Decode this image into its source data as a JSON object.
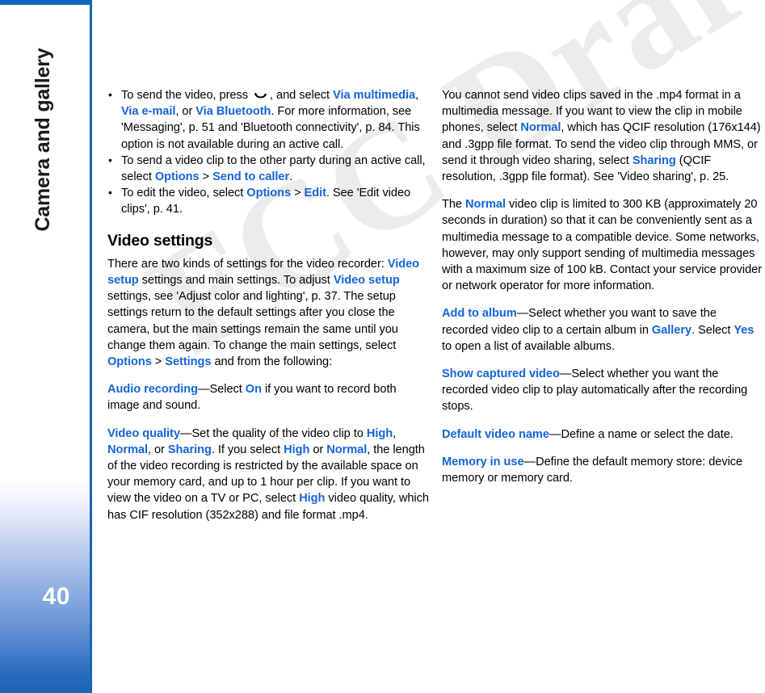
{
  "document": {
    "chapter_title": "Camera and gallery",
    "page_number": "40",
    "watermark_text": "FCC Draft",
    "accent_color": "#1565d8",
    "sidebar_border_color": "#1565c0",
    "sidebar_gradient_end": "#1b63b5"
  },
  "column_left": {
    "bullets": [
      {
        "id": "bullet-send-video",
        "segments": [
          {
            "t": "To send the video, press "
          },
          {
            "t": "",
            "icon": "call-key-icon"
          },
          {
            "t": ", and select "
          },
          {
            "t": "Via multimedia",
            "kw": true
          },
          {
            "t": ", "
          },
          {
            "t": "Via e-mail",
            "kw": true
          },
          {
            "t": ", or "
          },
          {
            "t": "Via Bluetooth",
            "kw": true
          },
          {
            "t": ". For more information, see 'Messaging', p. 51 and 'Bluetooth connectivity', p. 84. This option is not available during an active call."
          }
        ]
      },
      {
        "id": "bullet-send-to-caller",
        "segments": [
          {
            "t": "To send a video clip to the other party during an active call, select "
          },
          {
            "t": "Options",
            "kw": true
          },
          {
            "t": " > "
          },
          {
            "t": "Send to caller",
            "kw": true
          },
          {
            "t": "."
          }
        ]
      },
      {
        "id": "bullet-edit-video",
        "segments": [
          {
            "t": "To edit the video, select "
          },
          {
            "t": "Options",
            "kw": true
          },
          {
            "t": " > "
          },
          {
            "t": "Edit",
            "kw": true
          },
          {
            "t": ". See 'Edit video clips', p. 41."
          }
        ]
      }
    ],
    "heading": "Video settings",
    "paragraphs": [
      {
        "id": "para-video-settings-intro",
        "segments": [
          {
            "t": "There are two kinds of settings for the video recorder: "
          },
          {
            "t": "Video setup",
            "kw": true
          },
          {
            "t": " settings and main settings. To adjust "
          },
          {
            "t": "Video setup",
            "kw": true
          },
          {
            "t": " settings, see 'Adjust color and lighting', p. 37. The setup settings return to the default settings after you close the camera, but the main settings remain the same until you change them again. To change the main settings, select "
          },
          {
            "t": "Options",
            "kw": true
          },
          {
            "t": " > "
          },
          {
            "t": "Settings",
            "kw": true
          },
          {
            "t": " and from the following:"
          }
        ]
      },
      {
        "id": "para-audio-recording",
        "segments": [
          {
            "t": "Audio recording",
            "kw": true
          },
          {
            "t": "—Select "
          },
          {
            "t": "On",
            "kw": true
          },
          {
            "t": " if you want to record both image and sound."
          }
        ]
      },
      {
        "id": "para-video-quality",
        "segments": [
          {
            "t": "Video quality",
            "kw": true
          },
          {
            "t": "—Set the quality of the video clip to "
          },
          {
            "t": "High",
            "kw": true
          },
          {
            "t": ", "
          },
          {
            "t": "Normal",
            "kw": true
          },
          {
            "t": ", or "
          },
          {
            "t": "Sharing",
            "kw": true
          },
          {
            "t": ". If you select "
          },
          {
            "t": "High",
            "kw": true
          },
          {
            "t": " or "
          },
          {
            "t": "Normal",
            "kw": true
          },
          {
            "t": ", the length of the video recording is restricted by the available space on your memory card, and up to 1 hour per clip. If you want to view the video on a TV or PC, select "
          },
          {
            "t": "High",
            "kw": true
          },
          {
            "t": " video quality, which has CIF resolution (352x288) and file format .mp4."
          }
        ]
      }
    ]
  },
  "column_right": {
    "paragraphs": [
      {
        "id": "para-mp4-not-in-mms",
        "segments": [
          {
            "t": "You cannot send video clips saved in the .mp4 format in a multimedia message. If you want to view the clip in mobile phones, select "
          },
          {
            "t": "Normal",
            "kw": true
          },
          {
            "t": ", which has QCIF resolution (176x144) and .3gpp file format. To send the video clip through MMS, or send it through video sharing, select "
          },
          {
            "t": "Sharing",
            "kw": true
          },
          {
            "t": " (QCIF resolution, .3gpp file format). See 'Video sharing', p. 25."
          }
        ]
      },
      {
        "id": "para-normal-clip-limit",
        "segments": [
          {
            "t": "The "
          },
          {
            "t": "Normal",
            "kw": true
          },
          {
            "t": " video clip is limited to 300 KB (approximately 20 seconds in duration) so that it can be conveniently sent as a multimedia message to a compatible device. Some networks, however, may only support sending of multimedia messages with a maximum size of 100 kB. Contact your service provider or network operator for more information."
          }
        ]
      },
      {
        "id": "para-add-to-album",
        "segments": [
          {
            "t": "Add to album",
            "kw": true
          },
          {
            "t": "—Select whether you want to save the recorded video clip to a certain album in "
          },
          {
            "t": "Gallery",
            "kw": true
          },
          {
            "t": ". Select "
          },
          {
            "t": "Yes",
            "kw": true
          },
          {
            "t": " to open a list of available albums."
          }
        ]
      },
      {
        "id": "para-show-captured-video",
        "segments": [
          {
            "t": "Show captured video",
            "kw": true
          },
          {
            "t": "—Select whether you want the recorded video clip to play automatically after the recording stops."
          }
        ]
      },
      {
        "id": "para-default-video-name",
        "segments": [
          {
            "t": "Default video name",
            "kw": true
          },
          {
            "t": "—Define a name or select the date."
          }
        ]
      },
      {
        "id": "para-memory-in-use",
        "segments": [
          {
            "t": "Memory in use",
            "kw": true
          },
          {
            "t": "—Define the default memory store: device memory or memory card."
          }
        ]
      }
    ]
  }
}
